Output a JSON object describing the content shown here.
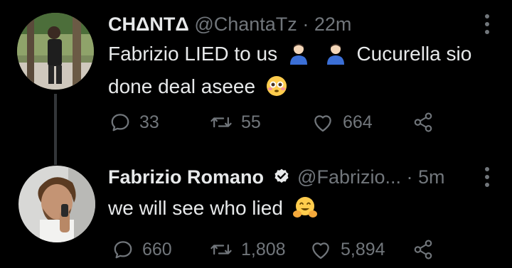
{
  "tweets": [
    {
      "display_name": "CHΔNTΔ",
      "handle": "@ChantaTz",
      "separator": "·",
      "time": "22m",
      "text_before": "Fabrizio LIED to us",
      "text_middle": "Cucurella sio",
      "text_after": "done deal aseee",
      "emojis": [
        "person-emoji",
        "person-emoji",
        "flushed-face-emoji"
      ],
      "stats": {
        "replies": "33",
        "retweets": "55",
        "likes": "664"
      }
    },
    {
      "display_name": "Fabrizio Romano",
      "verified": true,
      "handle": "@Fabrizio...",
      "separator": "·",
      "time": "5m",
      "text": "we will see who lied",
      "emojis": [
        "hugging-face-emoji"
      ],
      "stats": {
        "replies": "660",
        "retweets": "1,808",
        "likes": "5,894"
      }
    }
  ],
  "colors": {
    "background": "#000000",
    "primary_text": "#e7e9ea",
    "secondary_text": "#71767b",
    "thread_line": "#333639",
    "verified": "#e7e9ea"
  }
}
